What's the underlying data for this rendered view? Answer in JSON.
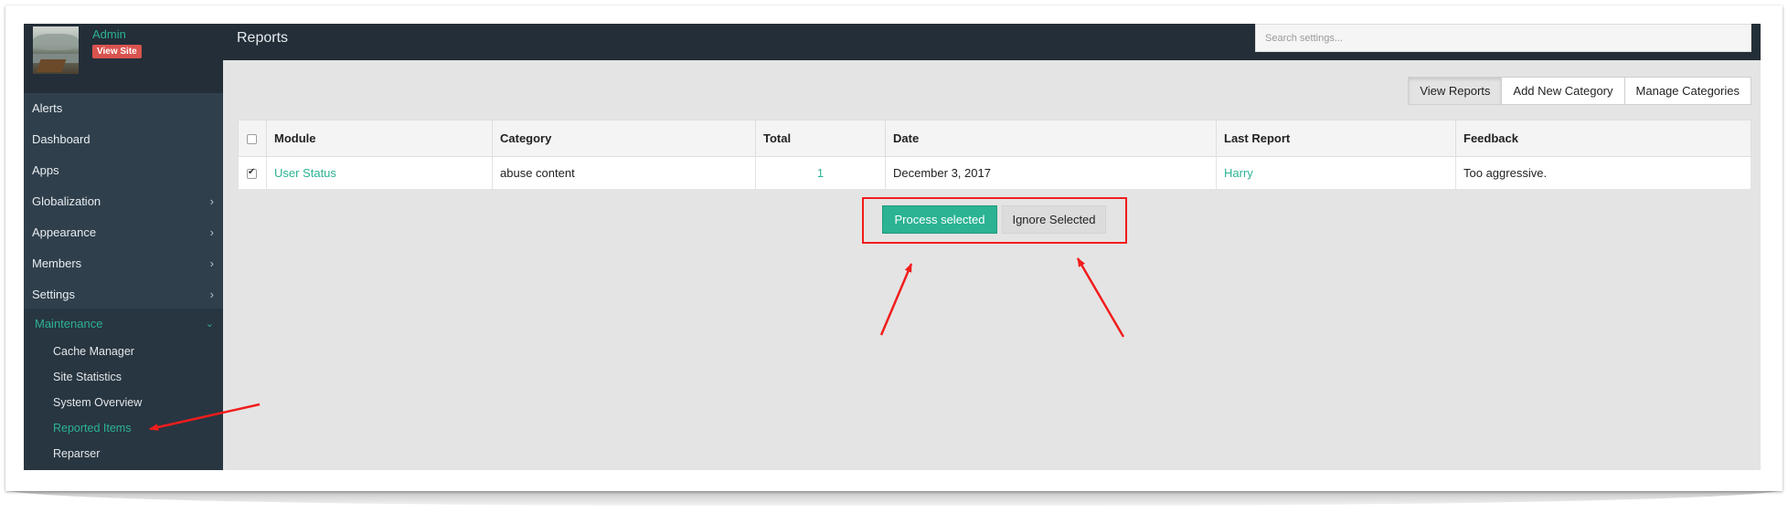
{
  "user": {
    "name": "Admin",
    "view_site_label": "View Site"
  },
  "sidebar": {
    "items": [
      {
        "label": "Alerts",
        "has_submenu": false
      },
      {
        "label": "Dashboard",
        "has_submenu": false
      },
      {
        "label": "Apps",
        "has_submenu": false
      },
      {
        "label": "Globalization",
        "has_submenu": true
      },
      {
        "label": "Appearance",
        "has_submenu": true
      },
      {
        "label": "Members",
        "has_submenu": true
      },
      {
        "label": "Settings",
        "has_submenu": true
      }
    ],
    "expanded": {
      "label": "Maintenance",
      "children": [
        "Cache Manager",
        "Site Statistics",
        "System Overview",
        "Reported Items",
        "Reparser"
      ],
      "active_child": "Reported Items"
    }
  },
  "header": {
    "title": "Reports",
    "search_placeholder": "Search settings..."
  },
  "tabs": [
    {
      "label": "View Reports",
      "active": true
    },
    {
      "label": "Add New Category",
      "active": false
    },
    {
      "label": "Manage Categories",
      "active": false
    }
  ],
  "table": {
    "columns": [
      "Module",
      "Category",
      "Total",
      "Date",
      "Last Report",
      "Feedback"
    ],
    "rows": [
      {
        "checked": true,
        "module": "User Status",
        "category": "abuse content",
        "total": "1",
        "date": "December 3, 2017",
        "last_report": "Harry",
        "feedback": "Too aggressive."
      }
    ]
  },
  "actions": {
    "process_label": "Process selected",
    "ignore_label": "Ignore Selected"
  },
  "colors": {
    "accent": "#2bb393",
    "sidebar_bg": "#2f3f4c",
    "topbar_bg": "#232e38",
    "annotation_red": "#f21c1c"
  }
}
